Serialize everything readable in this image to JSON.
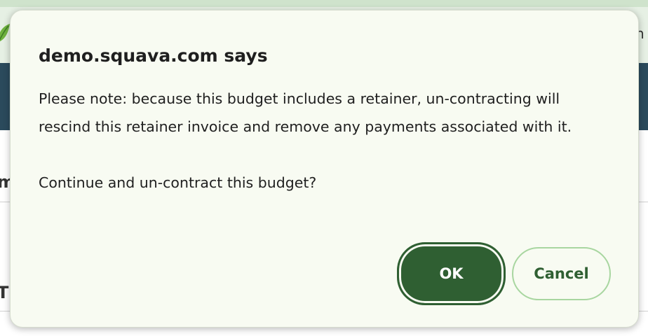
{
  "background": {
    "top_text": "n",
    "fragment_1": "m",
    "fragment_2": "Ti"
  },
  "dialog": {
    "title": "demo.squava.com says",
    "message_line1": "Please note: because this budget includes a retainer, un-contracting will rescind this retainer invoice and remove any payments associated with it.",
    "message_line2": "Continue and un-contract this budget?",
    "ok_label": "OK",
    "cancel_label": "Cancel"
  },
  "colors": {
    "primary_green": "#2f5f32",
    "light_green_border": "#a8d6a0",
    "dialog_bg": "#f8fbf2",
    "navbar": "#2b4a5c"
  }
}
